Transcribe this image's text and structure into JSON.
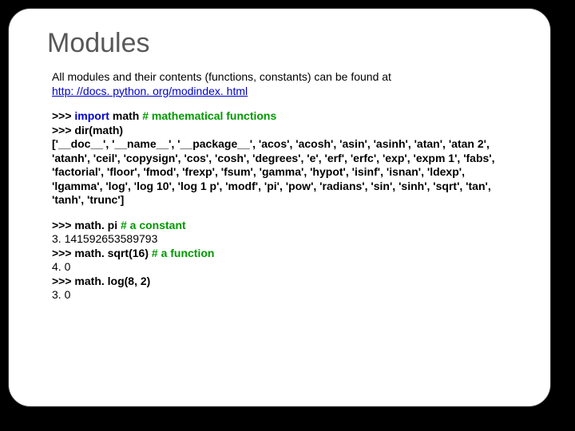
{
  "title": "Modules",
  "intro_text": "All modules and their contents (functions, constants) can be found at ",
  "intro_link": "http: //docs. python. org/modindex. html",
  "code1": {
    "p1a": ">>> ",
    "p1b": "import ",
    "p1c": "math ",
    "p1d": "# mathematical functions",
    "p2a": ">>> ",
    "p2b": "dir(math)",
    "dirlist": "['__doc__', '__name__', '__package__', 'acos', 'acosh', 'asin', 'asinh', 'atan', 'atan 2', 'atanh', 'ceil', 'copysign', 'cos', 'cosh', 'degrees', 'e', 'erf', 'erfc', 'exp', 'expm 1', 'fabs', 'factorial', 'floor', 'fmod', 'frexp', 'fsum', 'gamma', 'hypot', 'isinf', 'isnan', 'ldexp', 'lgamma', 'log', 'log 10', 'log 1 p', 'modf', 'pi', 'pow', 'radians', 'sin', 'sinh', 'sqrt', 'tan', 'tanh', 'trunc']"
  },
  "code2": {
    "l1a": ">>> math. pi  ",
    "l1b": "# a constant",
    "l2": "3. 141592653589793",
    "l3a": ">>> math. sqrt(16)  ",
    "l3b": "# a function",
    "l4": "4. 0",
    "l5": ">>> math. log(8, 2)",
    "l6": "3. 0"
  }
}
